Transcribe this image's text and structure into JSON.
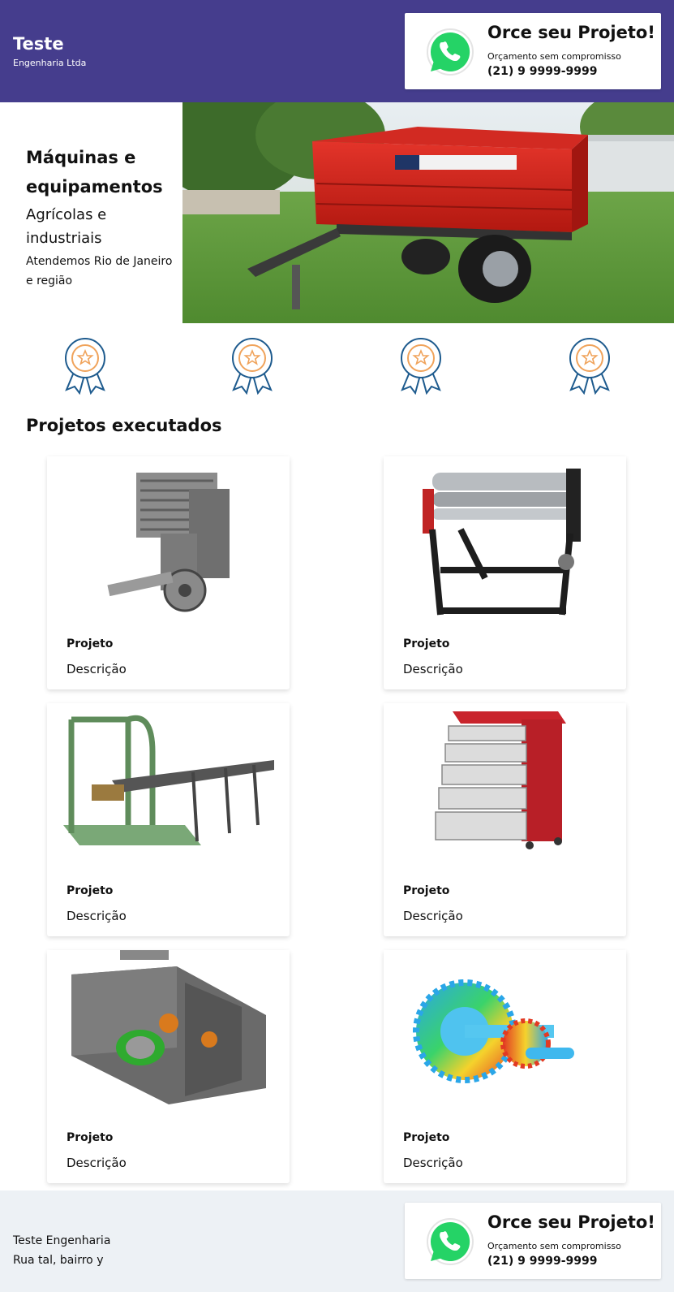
{
  "header": {
    "brand_title": "Teste",
    "brand_subtitle": "Engenharia Ltda",
    "cta": {
      "title": "Orce seu Projeto!",
      "subtitle": "Orçamento sem compromisso",
      "phone": "(21) 9 9999-9999",
      "icon": "whatsapp-icon"
    }
  },
  "hero": {
    "heading": "Máquinas e equipamentos",
    "subheading": "Agrícolas e industriais",
    "region": "Atendemos Rio de Janeiro e região",
    "image": "red-farm-trailer-photo"
  },
  "badges": [
    "award-ribbon-icon",
    "award-ribbon-icon",
    "award-ribbon-icon",
    "award-ribbon-icon"
  ],
  "projects": {
    "title": "Projetos executados",
    "items": [
      {
        "title": "Projeto",
        "description": "Descrição",
        "image": "engine-cad-render"
      },
      {
        "title": "Projeto",
        "description": "Descrição",
        "image": "plate-roller-machine"
      },
      {
        "title": "Projeto",
        "description": "Descrição",
        "image": "conveyor-line-cad"
      },
      {
        "title": "Projeto",
        "description": "Descrição",
        "image": "tool-cabinet-red"
      },
      {
        "title": "Projeto",
        "description": "Descrição",
        "image": "gearbox-cad-render"
      },
      {
        "title": "Projeto",
        "description": "Descrição",
        "image": "gear-fea-simulation"
      }
    ]
  },
  "footer": {
    "company": "Teste Engenharia",
    "address": "Rua tal, bairro y",
    "cta": {
      "title": "Orce seu Projeto!",
      "subtitle": "Orçamento sem compromisso",
      "phone": "(21) 9 9999-9999"
    }
  },
  "colors": {
    "header_bg": "#453d8d",
    "footer_bg": "#edf1f5",
    "whatsapp_green": "#25d366"
  }
}
